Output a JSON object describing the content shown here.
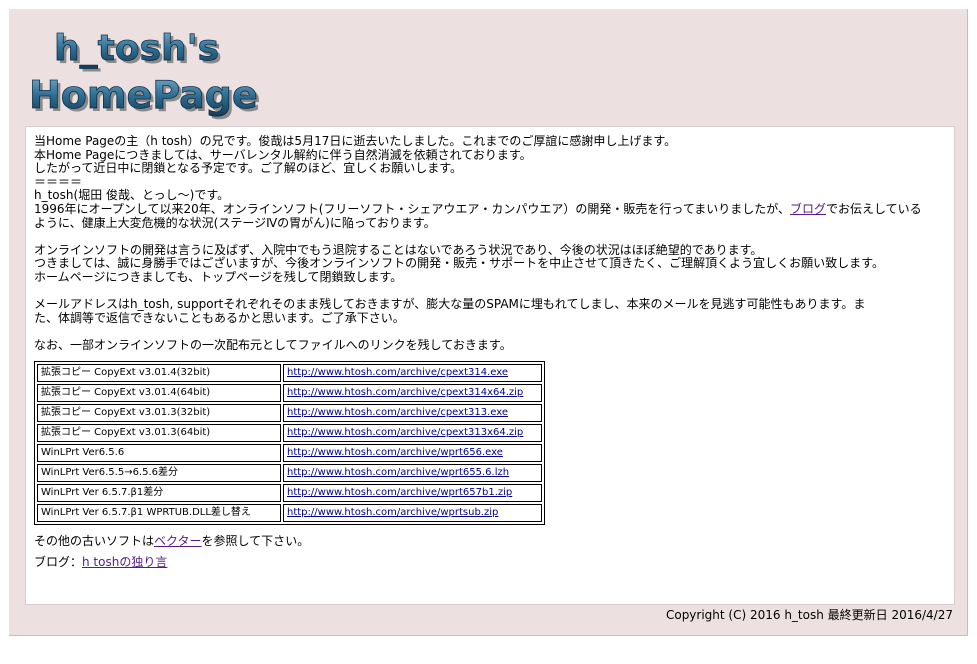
{
  "logo": {
    "line1": "h_tosh's",
    "line2": "HomePage"
  },
  "intro": {
    "l1": "当Home Pageの主（h tosh）の兄です。俊哉は5月17日に逝去いたしました。これまでのご厚誼に感謝申し上げます。",
    "l2": "本Home Pageにつきましては、サーバレンタル解約に伴う自然消滅を依頼されております。",
    "l3": "したがって近日中に閉鎖となる予定です。ご了解のほど、宜しくお願いします。",
    "separator": "＝＝＝＝",
    "l4": "h_tosh(堀田 俊哉、とっし～)です。",
    "l5_before": "1996年にオープンして以来20年、オンラインソフト(フリーソフト・シェアウエア・カンパウエア）の開発・販売を行ってまいりましたが、",
    "l5_link": "ブログ",
    "l5_after": "でお伝えしている",
    "l6": "ように、健康上大変危機的な状況(ステージⅣの胃がん)に陥っております。"
  },
  "para2": {
    "l1": "オンラインソフトの開発は言うに及ばず、入院中でもう退院することはないであろう状況であり、今後の状況はほぼ絶望的であります。",
    "l2": "つきましては、誠に身勝手ではございますが、今後オンラインソフトの開発・販売・サポートを中止させて頂きたく、ご理解頂くよう宜しくお願い致します。",
    "l3": "ホームページにつきましても、トップページを残して閉鎖致します。"
  },
  "para3": {
    "l1": "メールアドレスはh_tosh, supportそれぞれそのまま残しておきますが、膨大な量のSPAMに埋もれてしまし、本来のメールを見逃す可能性もあります。ま",
    "l2": "た、体調等で返信できないこともあるかと思います。ご了承下さい。"
  },
  "para4": "なお、一部オンラインソフトの一次配布元としてファイルへのリンクを残しておきます。",
  "files": [
    {
      "name": "拡張コピー CopyExt v3.01.4(32bit)",
      "url": "http://www.htosh.com/archive/cpext314.exe"
    },
    {
      "name": "拡張コピー CopyExt v3.01.4(64bit)",
      "url": "http://www.htosh.com/archive/cpext314x64.zip"
    },
    {
      "name": "拡張コピー CopyExt v3.01.3(32bit)",
      "url": "http://www.htosh.com/archive/cpext313.exe"
    },
    {
      "name": "拡張コピー CopyExt v3.01.3(64bit)",
      "url": "http://www.htosh.com/archive/cpext313x64.zip"
    },
    {
      "name": "WinLPrt Ver6.5.6",
      "url": "http://www.htosh.com/archive/wprt656.exe"
    },
    {
      "name": "WinLPrt Ver6.5.5→6.5.6差分",
      "url": "http://www.htosh.com/archive/wprt655.6.lzh"
    },
    {
      "name": "WinLPrt Ver 6.5.7.β1差分",
      "url": "http://www.htosh.com/archive/wprt657b1.zip"
    },
    {
      "name": "WinLPrt Ver 6.5.7.β1 WPRTUB.DLL差し替え",
      "url": "http://www.htosh.com/archive/wprtsub.zip"
    }
  ],
  "old_soft": {
    "before": "その他の古いソフトは",
    "link": "ベクター",
    "after": "を参照して下さい。"
  },
  "blog": {
    "label": "ブログ：",
    "link": "h toshの独り言"
  },
  "footer": "Copyright (C) 2016 h_tosh 最終更新日 2016/4/27"
}
